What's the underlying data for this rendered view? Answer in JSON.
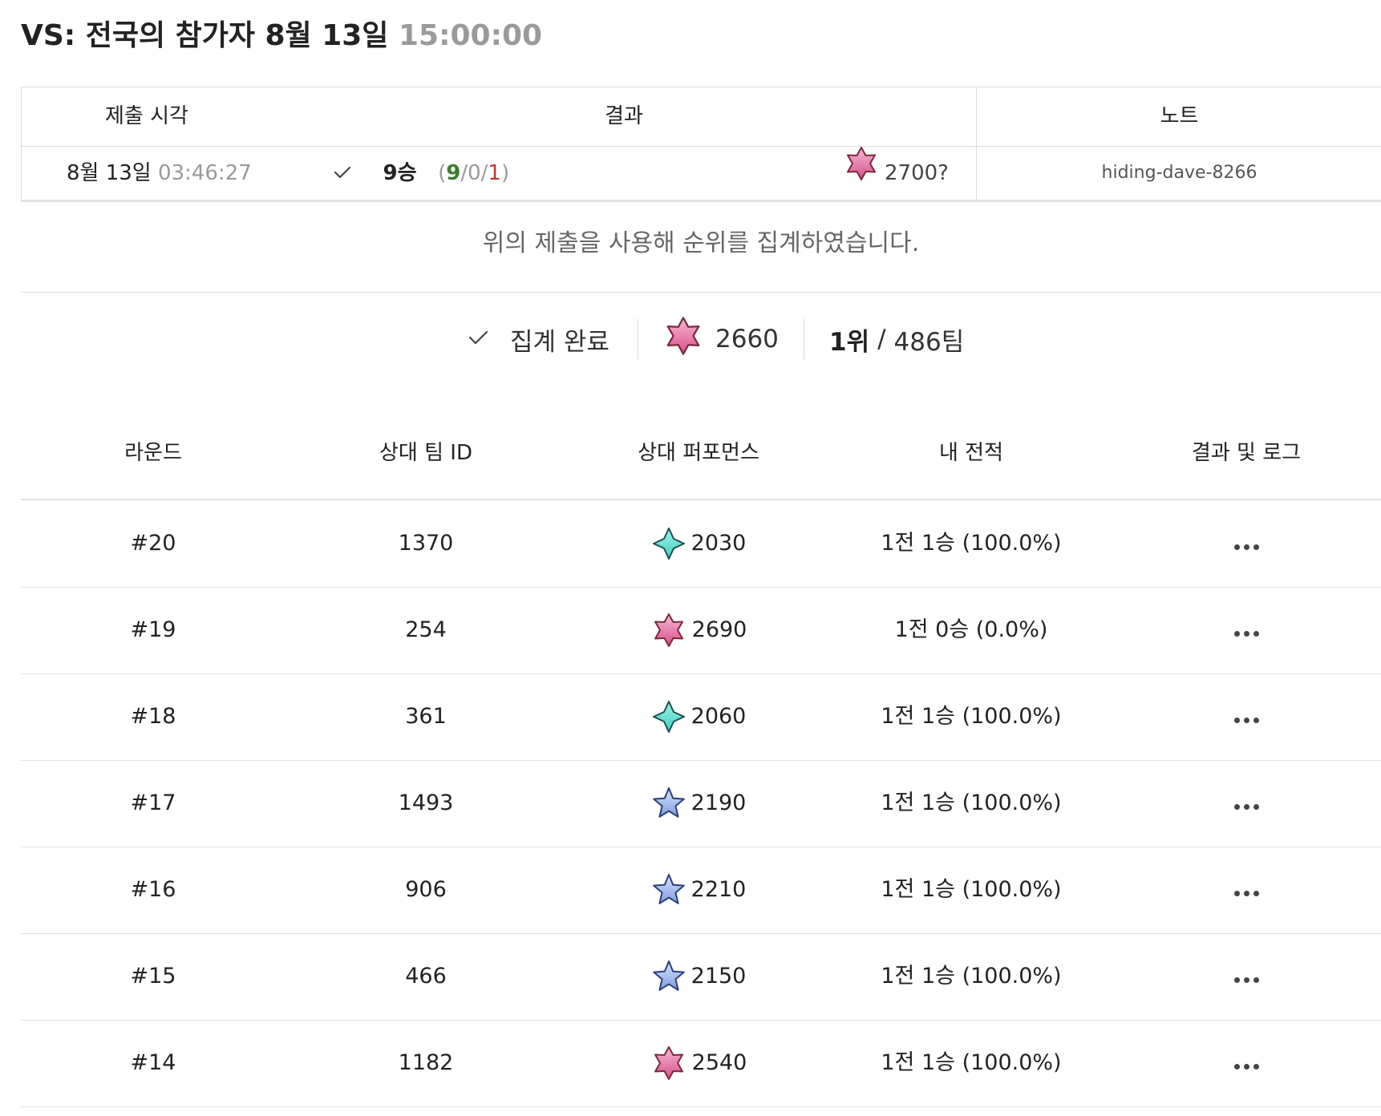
{
  "header": {
    "title": "VS: 전국의 참가자 8월 13일",
    "time": "15:00:00"
  },
  "submission": {
    "columns": [
      "제출 시각",
      "결과",
      "노트"
    ],
    "row": {
      "date": "8월 13일",
      "time": "03:46:27",
      "wins_label": "9승",
      "open_paren": "(",
      "wins": "9",
      "slash1": "/",
      "draws": "0",
      "slash2": "/",
      "losses": "1",
      "close_paren": ")",
      "rating": "2700?",
      "rating_icon": "pink-hexagram-icon",
      "note": "hiding-dave-8266"
    }
  },
  "notice": "위의 제출을 사용해 순위를 집계하였습니다.",
  "summary": {
    "status": "집계 완료",
    "rating": "2660",
    "rating_icon": "pink-hexagram-icon",
    "rank": "1위",
    "rank_sep": "/",
    "total": "486팀"
  },
  "rounds": {
    "columns": [
      "라운드",
      "상대 팀 ID",
      "상대 퍼포먼스",
      "내 전적",
      "결과 및 로그"
    ],
    "rows": [
      {
        "round": "#20",
        "team": "1370",
        "perf": "2030",
        "icon": "teal-four-point-star-icon",
        "record": "1전 1승 (100.0%)"
      },
      {
        "round": "#19",
        "team": "254",
        "perf": "2690",
        "icon": "pink-hexagram-icon",
        "record": "1전 0승 (0.0%)"
      },
      {
        "round": "#18",
        "team": "361",
        "perf": "2060",
        "icon": "teal-four-point-star-icon",
        "record": "1전 1승 (100.0%)"
      },
      {
        "round": "#17",
        "team": "1493",
        "perf": "2190",
        "icon": "blue-five-point-star-icon",
        "record": "1전 1승 (100.0%)"
      },
      {
        "round": "#16",
        "team": "906",
        "perf": "2210",
        "icon": "blue-five-point-star-icon",
        "record": "1전 1승 (100.0%)"
      },
      {
        "round": "#15",
        "team": "466",
        "perf": "2150",
        "icon": "blue-five-point-star-icon",
        "record": "1전 1승 (100.0%)"
      },
      {
        "round": "#14",
        "team": "1182",
        "perf": "2540",
        "icon": "pink-hexagram-icon",
        "record": "1전 1승 (100.0%)"
      }
    ]
  },
  "colors": {
    "win": "#3a7d2c",
    "loss": "#b23a32",
    "muted": "#9a9a9a",
    "pink_star": "#e879a8",
    "teal_star": "#5fe0d0",
    "blue_star": "#9db8ea"
  }
}
